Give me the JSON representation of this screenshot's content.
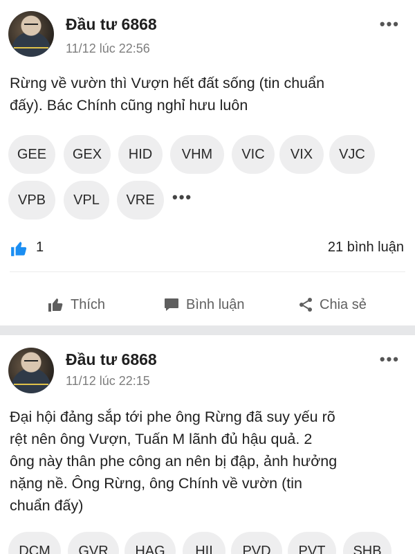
{
  "posts": [
    {
      "author": "Đầu tư 6868",
      "time": "11/12 lúc 22:56",
      "content_line1": "Rừng về vườn thì Vượn hết đất sống (tin chuẩn",
      "content_line2": "đấy). Bác Chính cũng nghỉ hưu luôn",
      "tags_row1": [
        "GEE",
        "GEX",
        "HID",
        "VHM",
        "VIC",
        "VIX",
        "VJC"
      ],
      "tags_row2": [
        "VPB",
        "VPL",
        "VRE"
      ],
      "more_tags": "•••",
      "likes": "1",
      "comments": "21 bình luận"
    },
    {
      "author": "Đầu tư 6868",
      "time": "11/12 lúc 22:15",
      "content_line1": "Đại hội đảng sắp tới phe ông Rừng đã suy yếu rõ",
      "content_line2": "rệt nên ông Vượn, Tuấn M lãnh đủ hậu quả. 2",
      "content_line3": "ông này thân phe công an nên bị đập, ảnh hưởng",
      "content_line4": "nặng nề. Ông Rừng, ông Chính về vườn (tin",
      "content_line5": "chuẩn đấy)",
      "tags_row1": [
        "DCM",
        "GVR",
        "HAG",
        "HII",
        "PVD",
        "PVT",
        "SHB"
      ]
    }
  ],
  "menu_icon": "•••",
  "actions": {
    "like_label": "Thích",
    "comment_label": "Bình luận",
    "share_label": "Chia sẻ"
  },
  "colors": {
    "like_blue": "#1b8ef2",
    "tag_bg": "#eeeeef",
    "separator": "#e6e7e9"
  }
}
